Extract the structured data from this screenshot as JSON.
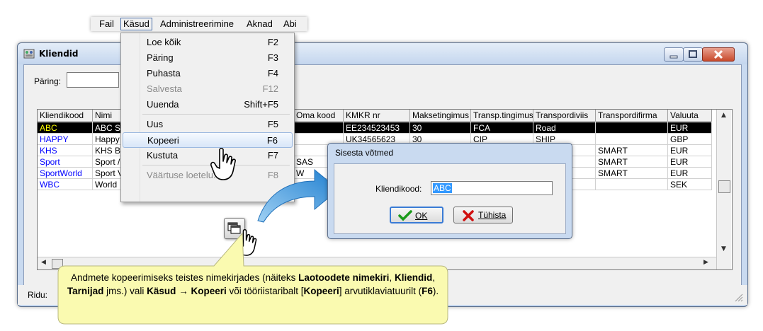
{
  "menubar": {
    "items": [
      "Fail",
      "Käsud",
      "Administreerimine",
      "Aknad",
      "Abi"
    ]
  },
  "window": {
    "title": "Kliendid",
    "query_label": "Päring:",
    "query_value": "",
    "rows_label": "Ridu:"
  },
  "grid": {
    "columns": [
      "Kliendikood",
      "Nimi",
      "Oma kood",
      "KMKR nr",
      "Maksetingimus",
      "Transp.tingimus",
      "Transpordiviis",
      "Transpordifirma",
      "Valuuta"
    ],
    "rows": [
      {
        "kood": "ABC",
        "nimi": "ABC S",
        "oma": "",
        "kmkr": "EE234523453",
        "makse": "30",
        "tingimus": "FCA",
        "viis": "Road",
        "firma": "",
        "valuuta": "EUR",
        "selected": true
      },
      {
        "kood": "HAPPY",
        "nimi": "Happy",
        "oma": "",
        "kmkr": "UK34565623",
        "makse": "30",
        "tingimus": "CIP",
        "viis": "SHIP",
        "firma": "",
        "valuuta": "GBP"
      },
      {
        "kood": "KHS",
        "nimi": "KHS B",
        "oma": "",
        "kmkr": "",
        "makse": "",
        "tingimus": "",
        "viis": "",
        "firma": "SMART",
        "valuuta": "EUR"
      },
      {
        "kood": "Sport",
        "nimi": "Sport /",
        "oma": "SAS",
        "kmkr": "",
        "makse": "",
        "tingimus": "",
        "viis": "",
        "firma": "SMART",
        "valuuta": "EUR"
      },
      {
        "kood": "SportWorld",
        "nimi": "Sport V",
        "oma": "W",
        "kmkr": "",
        "makse": "",
        "tingimus": "",
        "viis": "",
        "firma": "SMART",
        "valuuta": "EUR"
      },
      {
        "kood": "WBC",
        "nimi": "World",
        "oma": "",
        "kmkr": "",
        "makse": "",
        "tingimus": "",
        "viis": "",
        "firma": "",
        "valuuta": "SEK"
      }
    ]
  },
  "dropdown": {
    "items": [
      {
        "label": "Loe kõik",
        "shortcut": "F2",
        "disabled": false
      },
      {
        "label": "Päring",
        "shortcut": "F3",
        "disabled": false
      },
      {
        "label": "Puhasta",
        "shortcut": "F4",
        "disabled": false
      },
      {
        "label": "Salvesta",
        "shortcut": "F12",
        "disabled": true
      },
      {
        "label": "Uuenda",
        "shortcut": "Shift+F5",
        "disabled": false
      },
      {
        "label": "Uus",
        "shortcut": "F5",
        "disabled": false
      },
      {
        "label": "Kopeeri",
        "shortcut": "F6",
        "disabled": false,
        "highlighted": true
      },
      {
        "label": "Kustuta",
        "shortcut": "F7",
        "disabled": false
      },
      {
        "label": "Väärtuse loetelu...",
        "shortcut": "F8",
        "disabled": true
      }
    ]
  },
  "dialog": {
    "title": "Sisesta võtmed",
    "key_label": "Kliendikood:",
    "key_value": "ABC",
    "ok_label": "OK",
    "cancel_label": "Tühista"
  },
  "callout": {
    "t1": "Andmete kopeerimiseks teistes nimekirjades (näiteks ",
    "b1": "Laotoodete nimekiri",
    "t2": ", ",
    "b2": "Kliendid",
    "t3": ", ",
    "b3": "Tarnijad",
    "t4": " jms.) vali ",
    "b4": "Käsud",
    "arrow": " → ",
    "b5": "Kopeeri",
    "t5": " või tööriistaribalt [",
    "b6": "Kopeeri",
    "t6": "] arvutiklaviatuurilt (",
    "b7": "F6",
    "t7": ")."
  },
  "colors": {
    "selected_row_bg": "#000000",
    "selected_code_text": "#ffff00",
    "code_text": "#0000ff",
    "callout_bg": "#fafab0",
    "arrow_blue": "#2f8fd8"
  },
  "icons": [
    "window-icon",
    "minimize-icon",
    "maximize-icon",
    "close-icon",
    "copy-toolbar-icon",
    "hand-cursor-icon",
    "checkmark-icon",
    "cross-icon",
    "curved-arrow-icon"
  ]
}
